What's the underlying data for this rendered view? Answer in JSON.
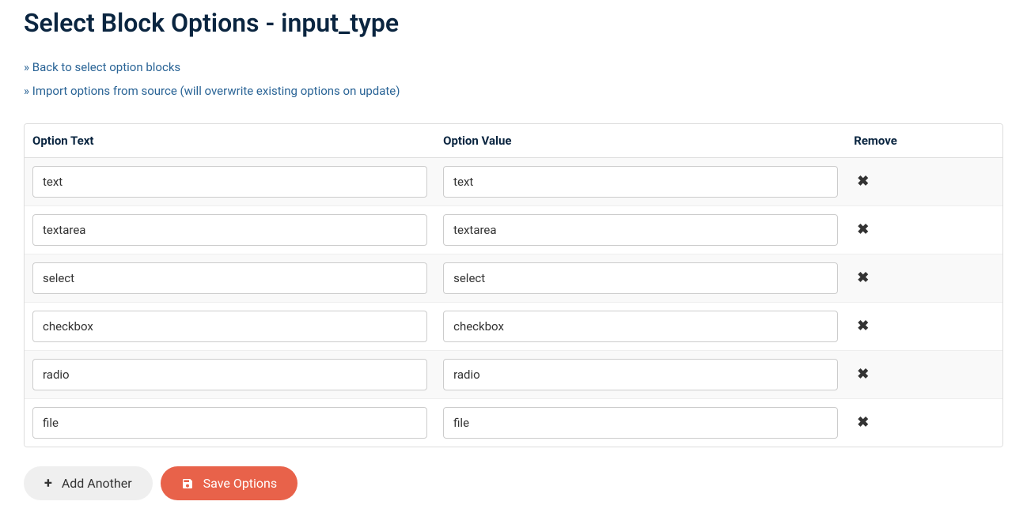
{
  "page": {
    "title": "Select Block Options - input_type"
  },
  "links": {
    "back": "» Back to select option blocks",
    "import": "» Import options from source (will overwrite existing options on update)"
  },
  "table": {
    "headers": {
      "text": "Option Text",
      "value": "Option Value",
      "remove": "Remove"
    },
    "rows": [
      {
        "text": "text",
        "value": "text"
      },
      {
        "text": "textarea",
        "value": "textarea"
      },
      {
        "text": "select",
        "value": "select"
      },
      {
        "text": "checkbox",
        "value": "checkbox"
      },
      {
        "text": "radio",
        "value": "radio"
      },
      {
        "text": "file",
        "value": "file"
      }
    ]
  },
  "buttons": {
    "add": "Add Another",
    "save": "Save Options"
  }
}
